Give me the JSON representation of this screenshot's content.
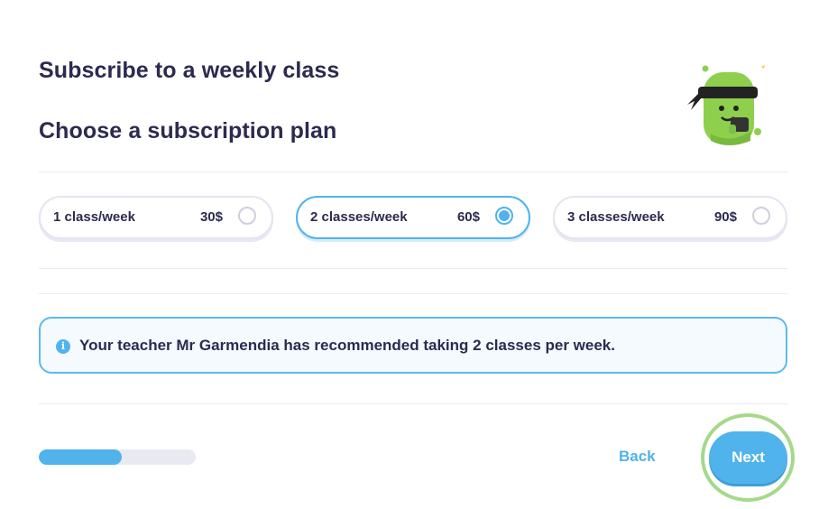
{
  "page": {
    "title": "Subscribe to a weekly class",
    "subtitle": "Choose a subscription plan"
  },
  "plans": [
    {
      "label": "1 class/week",
      "price": "30$",
      "selected": false
    },
    {
      "label": "2 classes/week",
      "price": "60$",
      "selected": true
    },
    {
      "label": "3 classes/week",
      "price": "90$",
      "selected": false
    }
  ],
  "notice": {
    "icon": "info-icon",
    "text": "Your teacher Mr Garmendia has recommended taking 2 classes per week."
  },
  "progress": {
    "fraction": 0.53
  },
  "footer": {
    "back_label": "Back",
    "next_label": "Next"
  },
  "colors": {
    "accent": "#50b3ec",
    "heading": "#2c2a50",
    "highlight_ring": "#a5d98a",
    "mascot_green": "#8ecf4d"
  }
}
